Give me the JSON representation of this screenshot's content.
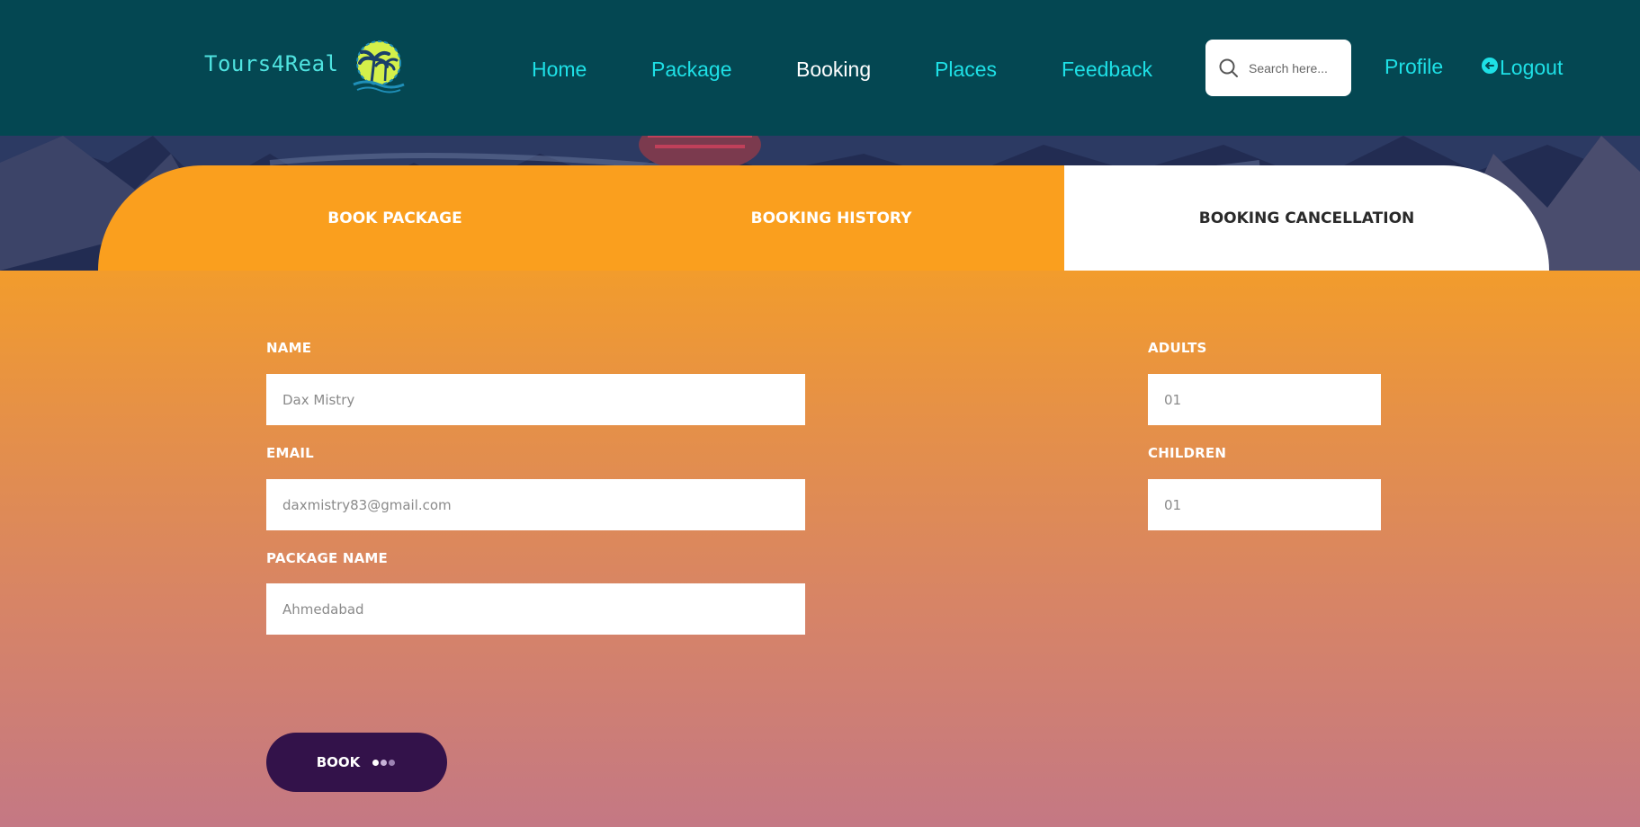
{
  "header": {
    "logo_text": "Tours4Real",
    "nav": [
      {
        "label": "Home",
        "active": false
      },
      {
        "label": "Package",
        "active": false
      },
      {
        "label": "Booking",
        "active": true
      },
      {
        "label": "Places",
        "active": false
      },
      {
        "label": "Feedback",
        "active": false
      }
    ],
    "search_placeholder": "Search here...",
    "profile_label": "Profile",
    "logout_label": "Logout"
  },
  "tabs": {
    "book_package": "BOOK PACKAGE",
    "booking_history": "BOOKING HISTORY",
    "booking_cancellation": "BOOKING CANCELLATION",
    "active": "booking_cancellation"
  },
  "form": {
    "name_label": "NAME",
    "name_value": "Dax Mistry",
    "email_label": "EMAIL",
    "email_value": "daxmistry83@gmail.com",
    "package_label": "PACKAGE NAME",
    "package_value": "Ahmedabad",
    "adults_label": "ADULTS",
    "adults_value": "01",
    "children_label": "CHILDREN",
    "children_value": "01",
    "submit_label": "BOOK"
  },
  "colors": {
    "header_bg": "#044752",
    "nav_link": "#1ee0e6",
    "tab_orange": "#fa9f1e",
    "button_bg": "#33124a"
  },
  "icons": {
    "logo": "palm-tree-sun-icon",
    "search": "search-icon",
    "logout": "logout-arrow-icon"
  }
}
